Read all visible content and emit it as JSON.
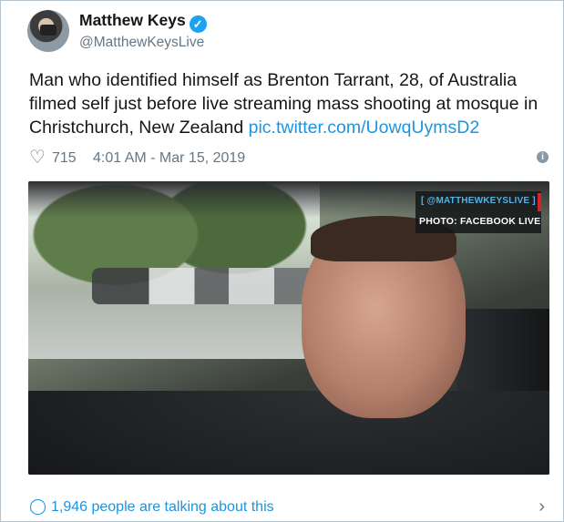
{
  "author": {
    "name": "Matthew Keys",
    "handle": "@MatthewKeysLive",
    "verified_glyph": "✓"
  },
  "tweet": {
    "text": "Man who identified himself as Brenton Tarrant, 28, of Australia filmed self just before live streaming mass shooting at mosque in Christchurch, New Zealand ",
    "link": "pic.twitter.com/UowqUymsD2"
  },
  "meta": {
    "like_icon": "♡",
    "likes": "715",
    "timestamp": "4:01 AM - Mar 15, 2019",
    "info_icon": "i"
  },
  "media": {
    "watermark_line1": "[ @MATTHEWKEYSLIVE ]",
    "watermark_line2": "PHOTO: FACEBOOK LIVE"
  },
  "footer": {
    "talk_icon": "◯",
    "talking_text": "1,946 people are talking about this",
    "chevron": "›"
  },
  "colors": {
    "link": "#1b95e0",
    "verified": "#1da1f2",
    "secondary_text": "#657786"
  }
}
